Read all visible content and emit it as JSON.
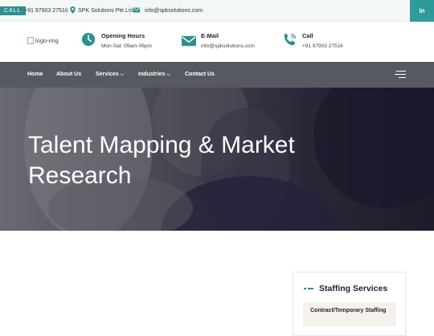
{
  "topbar": {
    "call_label": "CALL",
    "phone": "+91 97903 27516",
    "location": "SPK Solutions Pte.Ltd",
    "email": "info@spksolutions.com",
    "social": "in"
  },
  "header": {
    "logo_alt": "logo-img",
    "hours_title": "Opening Hours",
    "hours_value": "Mon-Sat: 09am-06pm",
    "email_title": "E-Mail",
    "email_value": "info@spksolutions.com",
    "call_title": "Call",
    "call_value": "+91 97903 27516"
  },
  "nav": {
    "items": [
      "Home",
      "About Us",
      "Services",
      "Industries",
      "Contact Us"
    ]
  },
  "hero": {
    "title": "Talent Mapping & Market Research"
  },
  "sidebar": {
    "title": "Staffing Services",
    "items": [
      "Contract/Temporary Staffing"
    ]
  },
  "colors": {
    "accent": "#2f8f8f",
    "nav_bg": "#565a60",
    "hero_bg": "#2a2838"
  }
}
